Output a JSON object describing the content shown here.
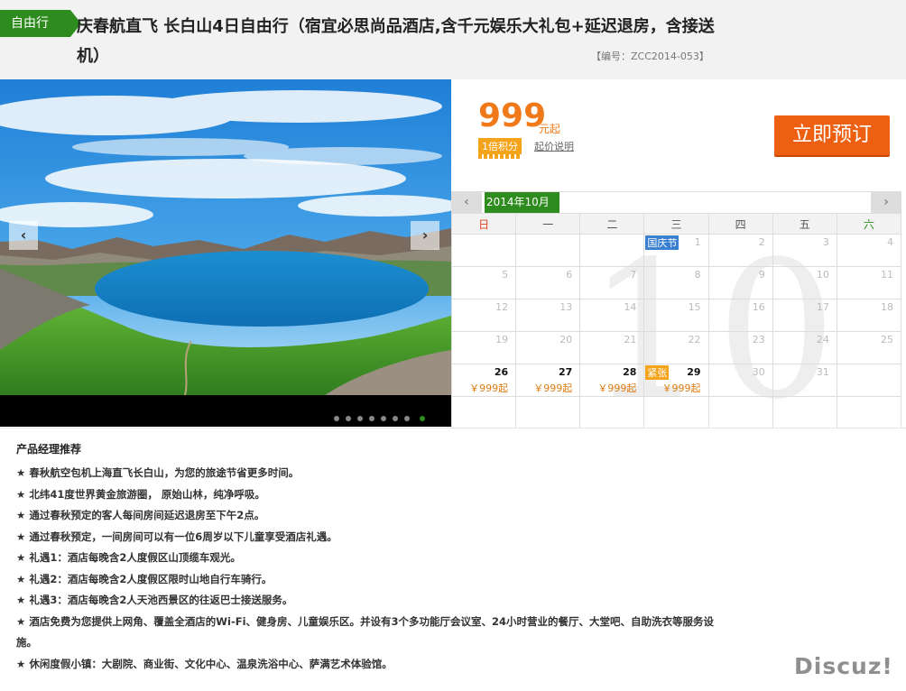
{
  "header": {
    "tag": "自由行",
    "title": "庆春航直飞 长白山4日自由行（宿宜必思尚品酒店,含千元娱乐大礼包+延迟退房，含接送机）",
    "code": "【编号：ZCC2014-053】"
  },
  "slideshow": {
    "prev_icon": "chevron-left-icon",
    "next_icon": "chevron-right-icon",
    "prev_glyph": "‹",
    "next_glyph": "›",
    "dot_count": 8,
    "active_dot": 8
  },
  "price": {
    "amount": "999",
    "unit": "元起",
    "points": "1倍积分",
    "note": "起价说明",
    "book_label": "立即预订"
  },
  "calendar": {
    "month_label": "2014年10月",
    "prev_glyph": "‹",
    "next_glyph": "›",
    "big_month": "10",
    "weekdays": [
      "日",
      "一",
      "二",
      "三",
      "四",
      "五",
      "六"
    ],
    "weeks": [
      [
        {
          "d": ""
        },
        {
          "d": ""
        },
        {
          "d": ""
        },
        {
          "d": "1",
          "badge": "国庆节",
          "badge_type": "holiday"
        },
        {
          "d": "2"
        },
        {
          "d": "3"
        },
        {
          "d": "4"
        }
      ],
      [
        {
          "d": "5"
        },
        {
          "d": "6"
        },
        {
          "d": "7"
        },
        {
          "d": "8"
        },
        {
          "d": "9"
        },
        {
          "d": "10"
        },
        {
          "d": "11"
        }
      ],
      [
        {
          "d": "12"
        },
        {
          "d": "13"
        },
        {
          "d": "14"
        },
        {
          "d": "15"
        },
        {
          "d": "16"
        },
        {
          "d": "17"
        },
        {
          "d": "18"
        }
      ],
      [
        {
          "d": "19"
        },
        {
          "d": "20"
        },
        {
          "d": "21"
        },
        {
          "d": "22"
        },
        {
          "d": "23"
        },
        {
          "d": "24"
        },
        {
          "d": "25"
        }
      ],
      [
        {
          "d": "26",
          "price": "￥999起"
        },
        {
          "d": "27",
          "price": "￥999起"
        },
        {
          "d": "28",
          "price": "￥999起"
        },
        {
          "d": "29",
          "price": "￥999起",
          "badge": "紧张",
          "badge_type": "hot"
        },
        {
          "d": "30"
        },
        {
          "d": "31"
        },
        {
          "d": ""
        }
      ],
      [
        {
          "d": ""
        },
        {
          "d": ""
        },
        {
          "d": ""
        },
        {
          "d": ""
        },
        {
          "d": ""
        },
        {
          "d": ""
        },
        {
          "d": ""
        }
      ]
    ]
  },
  "recommend": {
    "title": "产品经理推荐",
    "items": [
      "★ 春秋航空包机上海直飞长白山，为您的旅途节省更多时间。",
      "★ 北纬41度世界黄金旅游圈， 原始山林，纯净呼吸。",
      "★ 通过春秋预定的客人每间房间延迟退房至下午2点。",
      "★ 通过春秋预定，一间房间可以有一位6周岁以下儿童享受酒店礼遇。",
      "★ 礼遇1：酒店每晚含2人度假区山顶缆车观光。",
      "★ 礼遇2：酒店每晚含2人度假区限时山地自行车骑行。",
      "★ 礼遇3：酒店每晚含2人天池西景区的往返巴士接送服务。",
      "★ 酒店免费为您提供上网角、覆盖全酒店的Wi-Fi、健身房、儿童娱乐区。并设有3个多功能厅会议室、24小时营业的餐厅、大堂吧、自助洗衣等服务设施。",
      "★ 休闲度假小镇：大剧院、商业街、文化中心、温泉洗浴中心、萨满艺术体验馆。"
    ]
  },
  "watermark": "Discuz!"
}
